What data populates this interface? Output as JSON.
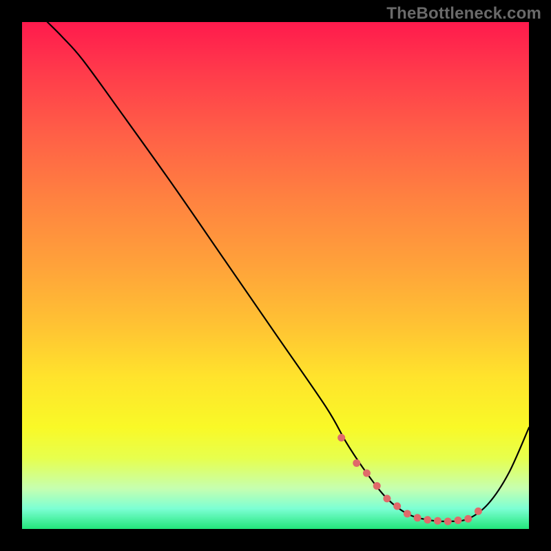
{
  "watermark": "TheBottleneck.com",
  "chart_data": {
    "type": "line",
    "title": "",
    "xlabel": "",
    "ylabel": "",
    "xlim": [
      0,
      100
    ],
    "ylim": [
      0,
      100
    ],
    "legend": false,
    "series": [
      {
        "name": "curve",
        "x": [
          5,
          8,
          12,
          20,
          30,
          40,
          50,
          60,
          64,
          68,
          72,
          76,
          80,
          84,
          88,
          92,
          96,
          100
        ],
        "y": [
          100,
          97,
          92.5,
          81.5,
          67.5,
          53,
          38.5,
          24,
          17,
          11,
          6,
          3,
          1.8,
          1.5,
          2,
          5,
          11,
          20
        ]
      }
    ],
    "markers": {
      "name": "highlight-dots",
      "color": "#e06a6a",
      "x": [
        63,
        66,
        68,
        70,
        72,
        74,
        76,
        78,
        80,
        82,
        84,
        86,
        88,
        90
      ],
      "y": [
        18,
        13,
        11,
        8.5,
        6,
        4.5,
        3,
        2.2,
        1.8,
        1.6,
        1.5,
        1.7,
        2,
        3.5
      ]
    }
  }
}
